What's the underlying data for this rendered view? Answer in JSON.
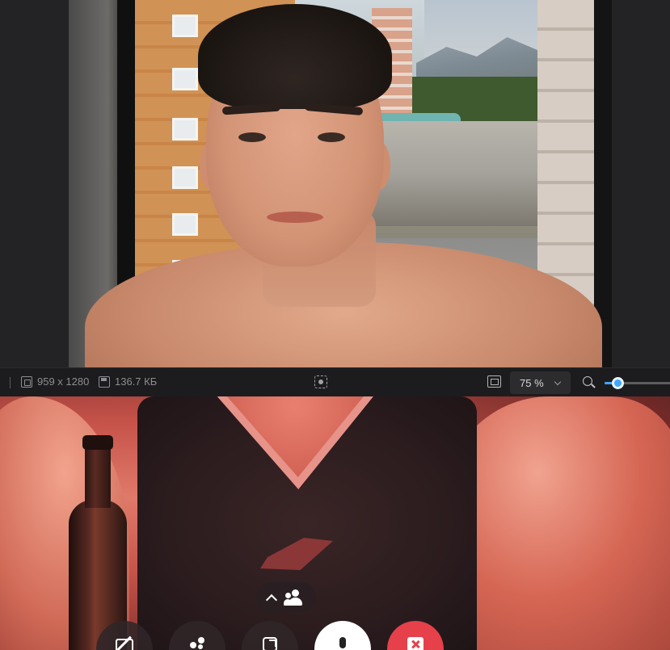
{
  "viewer": {
    "image_dimensions": "959 x 1280",
    "file_size": "136.7 КБ",
    "zoom": {
      "value": "75 %",
      "slider_fraction": 0.18
    },
    "icons": {
      "dimensions": "image-size-icon",
      "file_size": "save-disk-icon",
      "focus": "focus-frame-icon",
      "fit": "fit-to-window-icon",
      "zoom_dropdown": "chevron-down-icon",
      "zoom": "magnifier-icon"
    },
    "accent_color": "#3fa7ff"
  },
  "call": {
    "participants_icon": "participants-icon",
    "expand_icon": "chevron-up-icon",
    "controls": [
      {
        "name": "camera-off-button",
        "icon": "camera-off-icon"
      },
      {
        "name": "effects-button",
        "icon": "effects-icon"
      },
      {
        "name": "share-screen-button",
        "icon": "share-icon"
      },
      {
        "name": "microphone-button",
        "icon": "microphone-icon"
      },
      {
        "name": "end-call-button",
        "icon": "hang-up-icon"
      }
    ],
    "end_call_color": "#e6404a"
  }
}
